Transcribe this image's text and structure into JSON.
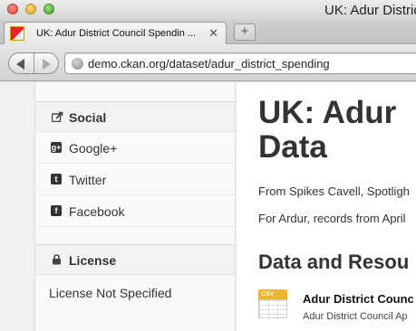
{
  "window": {
    "title": "UK: Adur Distric"
  },
  "tab": {
    "title": "UK: Adur District Council Spendin ...",
    "close": "✕",
    "new_tab": "+"
  },
  "toolbar": {
    "url": "demo.ckan.org/dataset/adur_district_spending"
  },
  "sidebar": {
    "social_heading": "Social",
    "items": [
      {
        "label": "Google+",
        "icon": "g+"
      },
      {
        "label": "Twitter",
        "icon": "t"
      },
      {
        "label": "Facebook",
        "icon": "f"
      }
    ],
    "license_heading": "License",
    "license_text": "License Not Specified"
  },
  "main": {
    "title_line1": "UK: Adur",
    "title_line2": "Data",
    "para1": "From Spikes Cavell, Spotligh",
    "para2": "For Ardur, records from April",
    "resources_heading": "Data and Resou",
    "resource": {
      "format": "CSV",
      "title": "Adur District Counc",
      "description": "Adur District Council Ap"
    }
  }
}
